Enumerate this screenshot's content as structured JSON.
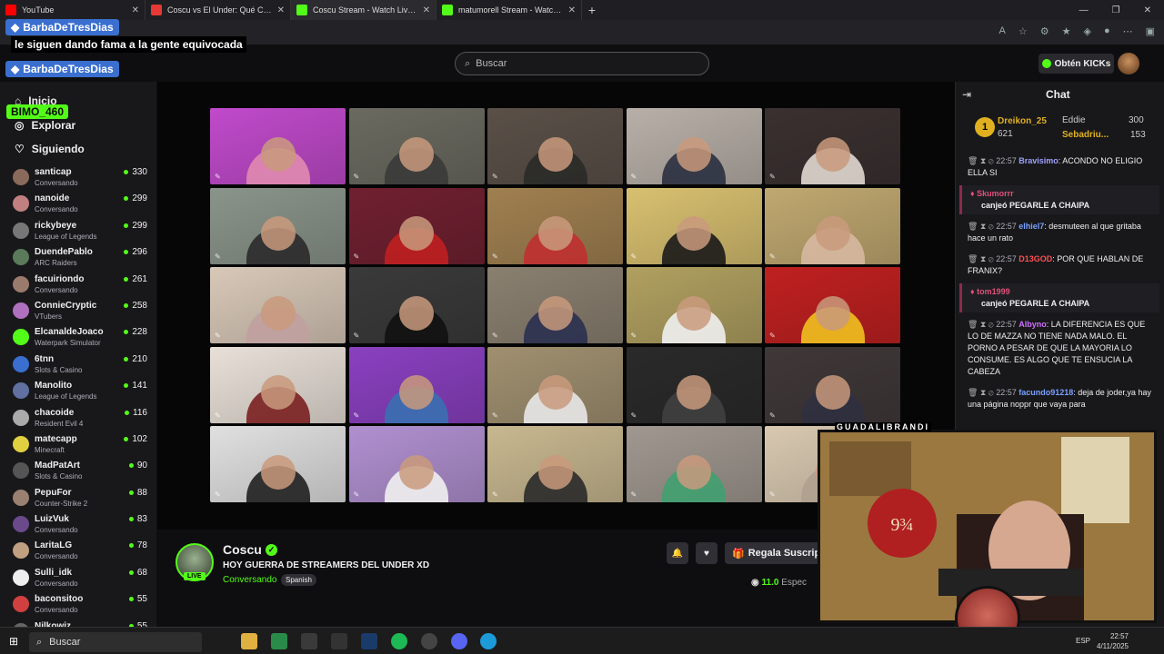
{
  "browser": {
    "tabs": [
      {
        "label": "YouTube",
        "color": "#ff0000",
        "active": false
      },
      {
        "label": "Coscu vs El Under: Qué CARAJOS",
        "color": "#e53935",
        "active": false
      },
      {
        "label": "Coscu Stream - Watch Live on Kick",
        "color": "#53fc18",
        "active": true
      },
      {
        "label": "matumorell Stream - Watch Live",
        "color": "#53fc18",
        "active": false
      }
    ],
    "new_tab": "+"
  },
  "overlay": {
    "user1": "BarbaDeTresDias",
    "message": "le siguen dando fama a la gente equivocada",
    "user2": "BarbaDeTresDias",
    "user3": "BIMO_460"
  },
  "header": {
    "search_placeholder": "Buscar",
    "get_kicks": "Obtén KICKs"
  },
  "sidebar": {
    "nav": {
      "home": "Inicio",
      "explore": "Explorar",
      "following": "Siguiendo"
    },
    "channels": [
      {
        "name": "santicap",
        "category": "Conversando",
        "viewers": "330",
        "color": "#8a6a5a"
      },
      {
        "name": "nanoide",
        "category": "Conversando",
        "viewers": "299",
        "color": "#c08080"
      },
      {
        "name": "rickybeye",
        "category": "League of Legends",
        "viewers": "299",
        "color": "#777"
      },
      {
        "name": "DuendePablo",
        "category": "ARC Raiders",
        "viewers": "296",
        "color": "#5a7a5a"
      },
      {
        "name": "facuiriondo",
        "category": "Conversando",
        "viewers": "261",
        "color": "#9a7a6a"
      },
      {
        "name": "ConnieCryptic",
        "category": "VTubers",
        "viewers": "258",
        "color": "#b070c0"
      },
      {
        "name": "ElcanaldeJoaco",
        "category": "Waterpark Simulator",
        "viewers": "228",
        "color": "#53fc18"
      },
      {
        "name": "6tnn",
        "category": "Slots & Casino",
        "viewers": "210",
        "color": "#3a6fd0"
      },
      {
        "name": "Manolito",
        "category": "League of Legends",
        "viewers": "141",
        "color": "#6070a0"
      },
      {
        "name": "chacoide",
        "category": "Resident Evil 4",
        "viewers": "116",
        "color": "#aaa"
      },
      {
        "name": "matecapp",
        "category": "Minecraft",
        "viewers": "102",
        "color": "#e0d040"
      },
      {
        "name": "MadPatArt",
        "category": "Slots & Casino",
        "viewers": "90",
        "color": "#555"
      },
      {
        "name": "PepuFor",
        "category": "Counter-Strike 2",
        "viewers": "88",
        "color": "#9a8070"
      },
      {
        "name": "LuizVuk",
        "category": "Conversando",
        "viewers": "83",
        "color": "#6a4a8a"
      },
      {
        "name": "LaritaLG",
        "category": "Conversando",
        "viewers": "78",
        "color": "#c0a080"
      },
      {
        "name": "Sulli_idk",
        "category": "Conversando",
        "viewers": "68",
        "color": "#eee"
      },
      {
        "name": "baconsitoo",
        "category": "Conversando",
        "viewers": "55",
        "color": "#d04040"
      },
      {
        "name": "Nilkowiz",
        "category": "",
        "viewers": "55",
        "color": "#666"
      }
    ]
  },
  "stream": {
    "channel": "Coscu",
    "live_badge": "LIVE",
    "title": "HOY GUERRA DE STREAMERS DEL UNDER XD",
    "category": "Conversando",
    "language": "Spanish",
    "gift_label": "Regala Suscrip",
    "viewers": "11.0",
    "viewers_suffix": "Espec"
  },
  "chat": {
    "title": "Chat",
    "gifters": [
      {
        "name": "Dreikon_25",
        "amount": "621",
        "rank": "1"
      },
      {
        "name": "Eddie",
        "amount": "300"
      },
      {
        "name": "Sebadriu...",
        "amount": "153"
      }
    ],
    "messages": [
      {
        "time": "22:57",
        "user": "Bravisimo",
        "text": "ACONDO NO ELIGIO ELLA SI",
        "color": "#a0a0ff",
        "redeem": false
      },
      {
        "user": "Skumorrr",
        "text": "canjeó PEGARLE A CHAIPA",
        "color": "#e0507a",
        "redeem": true
      },
      {
        "time": "22:57",
        "user": "elhiel7",
        "text": "desmuteen al que gritaba hace un rato",
        "color": "#7aa0ff",
        "redeem": false
      },
      {
        "time": "22:57",
        "user": "D13GOD",
        "text": "POR QUE HABLAN DE FRANIX?",
        "color": "#ff5050",
        "redeem": false
      },
      {
        "user": "tom1999",
        "text": "canjeó PEGARLE A CHAIPA",
        "color": "#e0507a",
        "redeem": true
      },
      {
        "time": "22:57",
        "user": "Albyno",
        "text": "LA DIFERENCIA ES QUE LO DE MAZZA NO TIENE NADA MALO. EL PORNO A PESAR DE QUE LA MAYORIA LO CONSUME. ES ALGO QUE TE ENSUCIA LA CABEZA",
        "color": "#d070ff",
        "redeem": false
      },
      {
        "time": "22:57",
        "user": "facundo91218",
        "text": "deja de joder,ya hay una página noppr que vaya para",
        "color": "#7aa0ff",
        "redeem": false
      }
    ]
  },
  "webcam": {
    "label": "GUADALIBRANDI"
  },
  "taskbar": {
    "search": "Buscar",
    "lang": "ESP",
    "time": "22:57",
    "date": "4/11/2025"
  },
  "colors": {
    "accent": "#53fc18",
    "background": "#0e0e10",
    "panel": "#18181b"
  }
}
